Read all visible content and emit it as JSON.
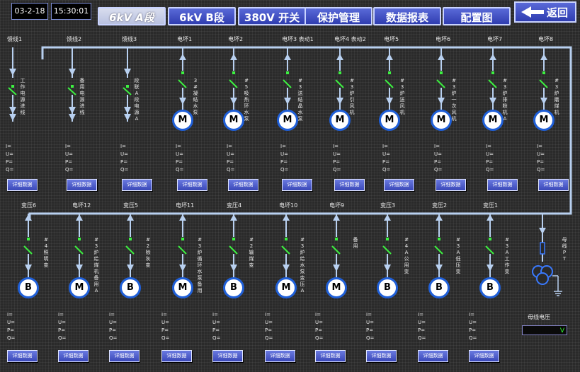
{
  "header": {
    "date": "03-2-18",
    "time": "15:30:01",
    "tabs": [
      "6kV A段",
      "6kV B段",
      "380V 开关",
      "保护管理",
      "数据报表",
      "配置图"
    ],
    "back_label": "返回"
  },
  "colors": {
    "bus": "#b8d0f0",
    "switch_closed": "#3cf040",
    "motor_border": "#1f5fd8",
    "button_bg": "#4a5ad0"
  },
  "top_feeders": [
    {
      "name": "馈线1",
      "type": "feed",
      "desc": "工作电源进线"
    },
    {
      "name": "馈线2",
      "type": "feed",
      "desc": "备用电源进线"
    },
    {
      "name": "馈线3",
      "type": "feed",
      "desc": "段联A段电源A"
    },
    {
      "name": "电坏1",
      "type": "M",
      "desc": "3#凝结水泵"
    },
    {
      "name": "电坏2",
      "type": "M",
      "desc": "#5吸热环水泵"
    },
    {
      "name": "电坏3 表动1",
      "type": "M",
      "desc": "#3送结晶水泵"
    },
    {
      "name": "电坏4 表动2",
      "type": "M",
      "desc": "#3炉引风机"
    },
    {
      "name": "电坏5",
      "type": "M",
      "desc": "#3炉送风机"
    },
    {
      "name": "电坏6",
      "type": "M",
      "desc": "#3炉一次风机"
    },
    {
      "name": "电坏7",
      "type": "M",
      "desc": "#3炉排粉机A"
    },
    {
      "name": "电坏8",
      "type": "M",
      "desc": "#3炉磨煤机"
    }
  ],
  "bottom_feeders": [
    {
      "name": "变压6",
      "type": "B",
      "desc": "#4照明变"
    },
    {
      "name": "电坏12",
      "type": "M",
      "desc": "#3炉给煤机备用A"
    },
    {
      "name": "变压5",
      "type": "B",
      "desc": "#2除灰变"
    },
    {
      "name": "电坏11",
      "type": "M",
      "desc": "#3炉循环水泵备用"
    },
    {
      "name": "变压4",
      "type": "B",
      "desc": "#2输煤变"
    },
    {
      "name": "电坏10",
      "type": "M",
      "desc": "#3炉给水泵变压A"
    },
    {
      "name": "电坏9",
      "type": "M",
      "desc": "备用"
    },
    {
      "name": "变压3",
      "type": "B",
      "desc": "#4A公用变"
    },
    {
      "name": "变压2",
      "type": "B",
      "desc": "#3A低压变"
    },
    {
      "name": "变压1",
      "type": "B",
      "desc": "#3A工作变"
    }
  ],
  "pt": {
    "desc": "母线PT"
  },
  "measure_labels": [
    "I=",
    "U=",
    "P=",
    "Q="
  ],
  "detail_label": "详细数据",
  "bus_voltage": {
    "label": "母线电压",
    "value": "V"
  }
}
